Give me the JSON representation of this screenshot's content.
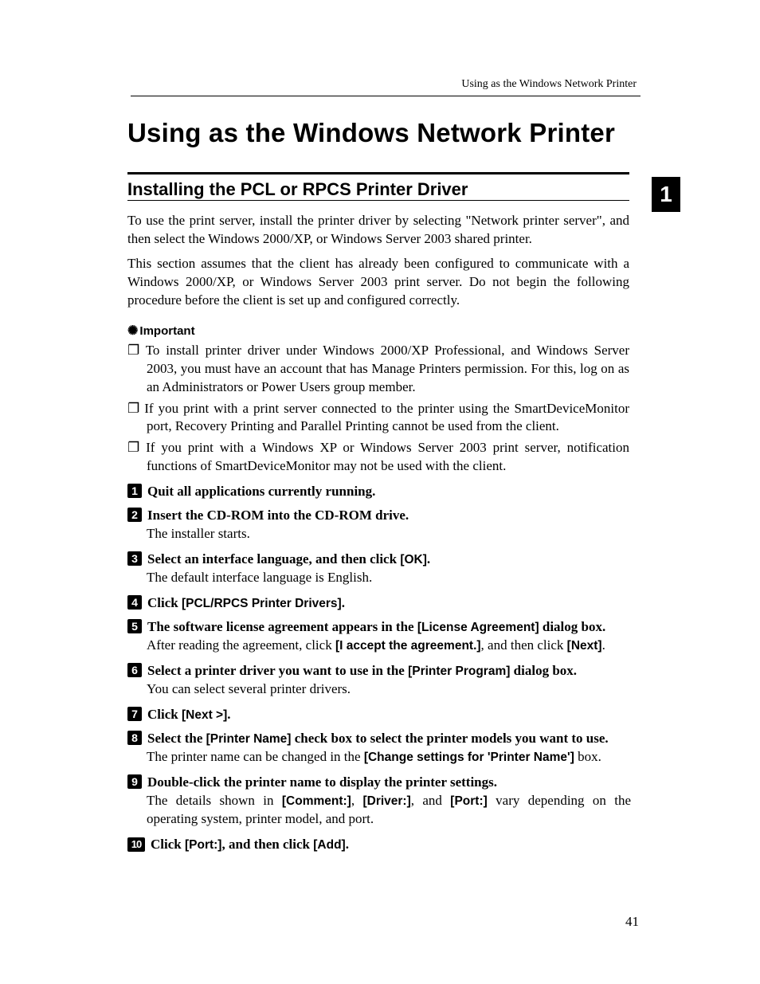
{
  "running_head": "Using as the Windows Network Printer",
  "chapter_tab": "1",
  "main_title": "Using as the Windows Network Printer",
  "section_title": "Installing the PCL or RPCS Printer Driver",
  "intro_p1": "To use the print server, install the printer driver by selecting \"Network printer server\", and then select the Windows 2000/XP, or Windows Server 2003 shared printer.",
  "intro_p2": "This section assumes that the client has already been configured to communicate with a Windows 2000/XP, or Windows Server 2003 print server. Do not begin the following procedure before the client is set up and configured correctly.",
  "important_label": "Important",
  "bullets": [
    "To install printer driver under Windows 2000/XP Professional, and Windows Server 2003, you must have an account that has Manage Printers permission. For this, log on as an Administrators or Power Users group member.",
    "If you print with a print server connected to the printer using the SmartDeviceMonitor port, Recovery Printing and Parallel Printing cannot be used from the client.",
    "If you print with a Windows XP or Windows Server 2003 print server, notification functions of SmartDeviceMonitor may not be used with the client."
  ],
  "steps": {
    "s1_title": "Quit all applications currently running.",
    "s2_title": "Insert the CD-ROM into the CD-ROM drive.",
    "s2_body": "The installer starts.",
    "s3_title_a": "Select an interface language, and then click ",
    "s3_ok": "[OK]",
    "s3_title_b": ".",
    "s3_body": "The default interface language is English.",
    "s4_title_a": "Click ",
    "s4_btn": "[PCL/RPCS Printer Drivers]",
    "s4_title_b": ".",
    "s5_title_a": "The software license agreement appears in the ",
    "s5_dlg": "[License Agreement]",
    "s5_title_b": " dialog box.",
    "s5_body_a": "After reading the agreement, click ",
    "s5_accept": "[I accept the agreement.]",
    "s5_body_b": ", and then click ",
    "s5_next": "[Next]",
    "s5_body_c": ".",
    "s6_title_a": "Select a printer driver you want to use in the ",
    "s6_dlg": "[Printer Program]",
    "s6_title_b": " dialog box.",
    "s6_body": "You can select several printer drivers.",
    "s7_title_a": "Click ",
    "s7_btn": "[Next >]",
    "s7_title_b": ".",
    "s8_title_a": "Select the ",
    "s8_chk": "[Printer Name]",
    "s8_title_b": " check box to select the printer models you want to use.",
    "s8_body_a": "The printer name can be changed in the ",
    "s8_box": "[Change settings for 'Printer Name']",
    "s8_body_b": " box.",
    "s9_title": "Double-click the printer name to display the printer settings.",
    "s9_body_a": "The details shown in ",
    "s9_c": "[Comment:]",
    "s9_body_b": ", ",
    "s9_d": "[Driver:]",
    "s9_body_c": ", and ",
    "s9_p": "[Port:]",
    "s9_body_d": " vary depending on the operating system, printer model, and port.",
    "s10_title_a": "Click ",
    "s10_port": "[Port:]",
    "s10_title_b": ", and then click ",
    "s10_add": "[Add]",
    "s10_title_c": "."
  },
  "page_number": "41"
}
